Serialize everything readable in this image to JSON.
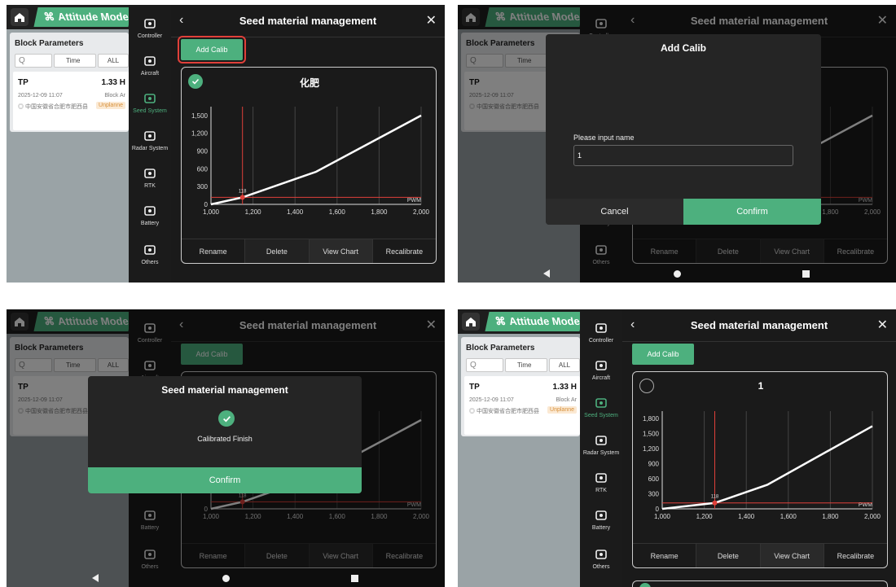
{
  "app": {
    "mode_label": "Attitude Mode",
    "block_params_title": "Block Parameters",
    "search_placeholder": "Q",
    "filter_time": "Time",
    "filter_all": "ALL",
    "block_name": "TP",
    "block_area": "1.33 H",
    "block_date": "2025-12-09 11:07",
    "block_location": "中国安徽省合肥市肥西县",
    "block_type": "Block Ar",
    "block_status": "Unplanne"
  },
  "nav": {
    "items": [
      {
        "label": "Controller",
        "icon": "controller-icon"
      },
      {
        "label": "Aircraft",
        "icon": "aircraft-icon"
      },
      {
        "label": "Seed System",
        "icon": "seed-system-icon"
      },
      {
        "label": "Radar System",
        "icon": "radar-icon"
      },
      {
        "label": "RTK",
        "icon": "rtk-icon"
      },
      {
        "label": "Battery",
        "icon": "battery-icon"
      },
      {
        "label": "Others",
        "icon": "gear-icon"
      }
    ]
  },
  "page": {
    "title": "Seed material management",
    "add_calib": "Add Calib",
    "actions": [
      "Rename",
      "Delete",
      "View Chart",
      "Recalibrate"
    ]
  },
  "panels": {
    "tl": {
      "card_name": "化肥"
    },
    "br": {
      "card_name": "1"
    }
  },
  "dialogs": {
    "add_calib": {
      "title": "Add Calib",
      "input_label": "Please input name",
      "input_value": "1",
      "cancel": "Cancel",
      "confirm": "Confirm"
    },
    "finish": {
      "title": "Seed material management",
      "message": "Calibrated Finish",
      "confirm": "Confirm"
    }
  },
  "chart_data": [
    {
      "type": "line",
      "xlabel": "PWM",
      "ylabel": "",
      "xlim": [
        1000,
        2000
      ],
      "ylim": [
        0,
        1650
      ],
      "x_ticks": [
        "1,000",
        "1,200",
        "1,400",
        "1,600",
        "1,800",
        "2,000"
      ],
      "y_ticks": [
        "0",
        "300",
        "600",
        "900",
        "1,200",
        "1,500"
      ],
      "x": [
        1000,
        1150,
        1500,
        2000
      ],
      "y": [
        0,
        118,
        550,
        1500
      ],
      "marker": {
        "x": 1150,
        "y": 118,
        "label": "118"
      }
    },
    {
      "type": "line",
      "xlabel": "PWM",
      "ylabel": "",
      "xlim": [
        1000,
        2000
      ],
      "ylim": [
        0,
        1950
      ],
      "x_ticks": [
        "1,000",
        "1,200",
        "1,400",
        "1,600",
        "1,800",
        "2,000"
      ],
      "y_ticks": [
        "0",
        "300",
        "600",
        "900",
        "1,200",
        "1,500",
        "1,800"
      ],
      "x": [
        1000,
        1250,
        1500,
        2000
      ],
      "y": [
        0,
        118,
        480,
        1650
      ],
      "marker": {
        "x": 1250,
        "y": 118,
        "label": "118"
      }
    }
  ],
  "colors": {
    "accent": "#4db07e",
    "danger": "#e0403a"
  }
}
